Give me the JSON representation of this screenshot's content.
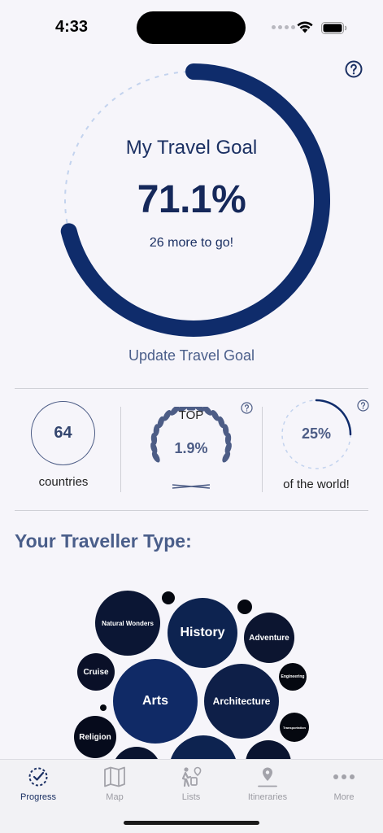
{
  "status_bar": {
    "time": "4:33"
  },
  "goal": {
    "title": "My Travel Goal",
    "percent": "71.1%",
    "progress_fraction": 0.711,
    "remaining_text": "26 more to go!",
    "update_label": "Update Travel Goal"
  },
  "stats": {
    "countries_value": "64",
    "countries_label": "countries",
    "rank_label": "TOP",
    "rank_value": "1.9%",
    "world_value": "25%",
    "world_fraction": 0.25,
    "world_label": "of the world!"
  },
  "traveller_type": {
    "title": "Your Traveller Type:",
    "bubbles": [
      {
        "label": "Natural Wonders"
      },
      {
        "label": "History"
      },
      {
        "label": "Adventure"
      },
      {
        "label": "Cruise"
      },
      {
        "label": "Arts"
      },
      {
        "label": "Architecture"
      },
      {
        "label": "Engineering"
      },
      {
        "label": "Transportation"
      },
      {
        "label": "Religion"
      },
      {
        "label": ""
      },
      {
        "label": ""
      },
      {
        "label": ""
      },
      {
        "label": ""
      },
      {
        "label": ""
      },
      {
        "label": ""
      }
    ]
  },
  "tabs": [
    {
      "label": "Progress",
      "icon": "progress-icon",
      "active": true
    },
    {
      "label": "Map",
      "icon": "map-icon",
      "active": false
    },
    {
      "label": "Lists",
      "icon": "lists-icon",
      "active": false
    },
    {
      "label": "Itineraries",
      "icon": "itineraries-icon",
      "active": false
    },
    {
      "label": "More",
      "icon": "more-icon",
      "active": false
    }
  ],
  "colors": {
    "primary": "#0f2c6b",
    "accent_muted": "#4d5d86",
    "dashed_track": "#c3d3ee",
    "background": "#f6f5fa"
  }
}
